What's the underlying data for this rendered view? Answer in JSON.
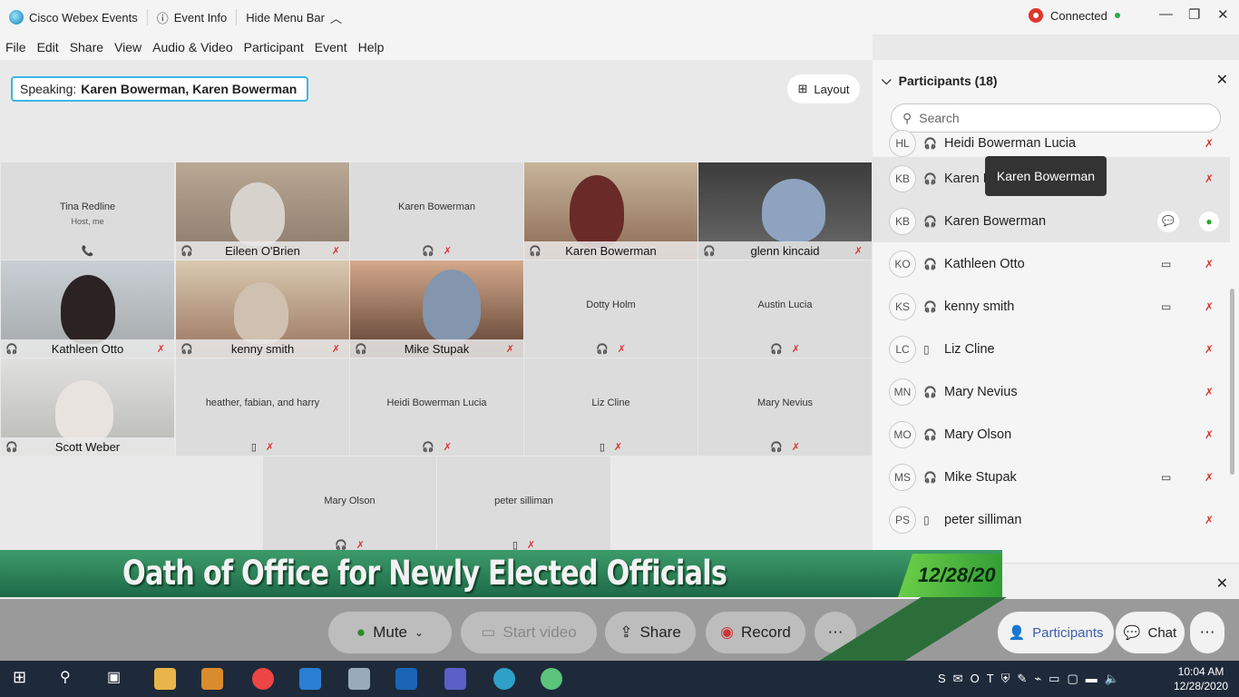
{
  "window": {
    "app_name": "Cisco Webex Events",
    "event_info": "Event Info",
    "hide_menu": "Hide Menu Bar",
    "status": "Connected"
  },
  "menu": [
    "File",
    "Edit",
    "Share",
    "View",
    "Audio & Video",
    "Participant",
    "Event",
    "Help"
  ],
  "speaking": {
    "label": "Speaking:",
    "names": "Karen Bowerman, Karen Bowerman"
  },
  "layout_button": "Layout",
  "tiles": [
    {
      "name": "Tina Redline",
      "sub": "Host, me"
    },
    {
      "name": "Eileen O'Brien"
    },
    {
      "name": "Karen Bowerman"
    },
    {
      "name": "Karen Bowerman"
    },
    {
      "name": "glenn kincaid"
    },
    {
      "name": "Kathleen Otto"
    },
    {
      "name": "kenny smith"
    },
    {
      "name": "Mike Stupak"
    },
    {
      "name": "Dotty Holm"
    },
    {
      "name": "Austin Lucia"
    },
    {
      "name": "Scott Weber"
    },
    {
      "name": "heather, fabian, and harry"
    },
    {
      "name": "Heidi Bowerman Lucia"
    },
    {
      "name": "Liz Cline"
    },
    {
      "name": "Mary Nevius"
    },
    {
      "name": "Mary Olson"
    },
    {
      "name": "peter silliman"
    }
  ],
  "participants_panel": {
    "title": "Participants (18)",
    "search_placeholder": "Search",
    "tooltip": "Karen Bowerman",
    "rows": [
      {
        "initials": "HL",
        "name": "Heidi Bowerman Lucia"
      },
      {
        "initials": "KB",
        "name": "Karen Bowerman"
      },
      {
        "initials": "KB",
        "name": "Karen Bowerman"
      },
      {
        "initials": "KO",
        "name": "Kathleen Otto"
      },
      {
        "initials": "KS",
        "name": "kenny smith"
      },
      {
        "initials": "LC",
        "name": "Liz Cline"
      },
      {
        "initials": "MN",
        "name": "Mary Nevius"
      },
      {
        "initials": "MO",
        "name": "Mary Olson"
      },
      {
        "initials": "MS",
        "name": "Mike Stupak"
      },
      {
        "initials": "PS",
        "name": "peter silliman"
      }
    ]
  },
  "banner": {
    "title": "Oath of Office for Newly Elected Officials",
    "date": "12/28/20"
  },
  "controls": {
    "mute": "Mute",
    "start_video": "Start video",
    "share": "Share",
    "record": "Record",
    "participants": "Participants",
    "chat": "Chat"
  },
  "taskbar": {
    "time": "10:04 AM",
    "date": "12/28/2020"
  }
}
